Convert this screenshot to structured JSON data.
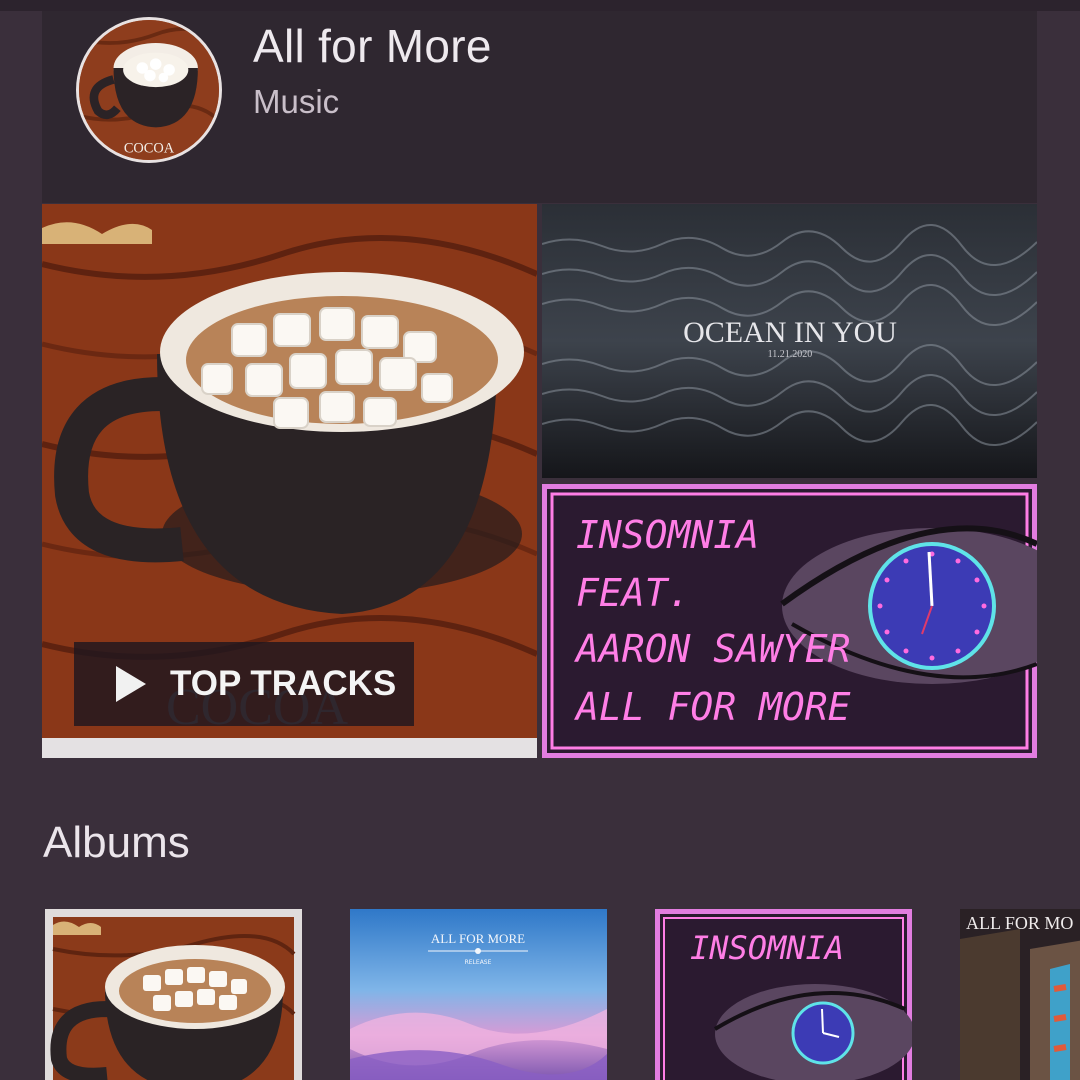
{
  "header": {
    "title": "All for More",
    "subtitle": "Music",
    "avatar_label": "COCOA"
  },
  "tiles": {
    "cocoa": {
      "art_text": "COCOA",
      "button_label": "TOP TRACKS"
    },
    "ocean": {
      "title": "OCEAN IN YOU",
      "date": "11.21.2020"
    },
    "insomnia": {
      "lines": [
        "INSOMNIA",
        "FEAT.",
        "AARON SAWYER",
        "ALL FOR MORE"
      ]
    }
  },
  "albums_section": {
    "title": "Albums",
    "items": [
      {
        "art_text": ""
      },
      {
        "art_text": "ALL FOR MORE",
        "art_subtext": "RELEASE"
      },
      {
        "art_text": "INSOMNIA"
      },
      {
        "art_text": "ALL FOR MO"
      }
    ]
  },
  "colors": {
    "background": "#3a2f3b",
    "header_card": "#2f2730",
    "neon_pink": "#ff5bd6",
    "neon_cyan": "#5fe3e8"
  }
}
